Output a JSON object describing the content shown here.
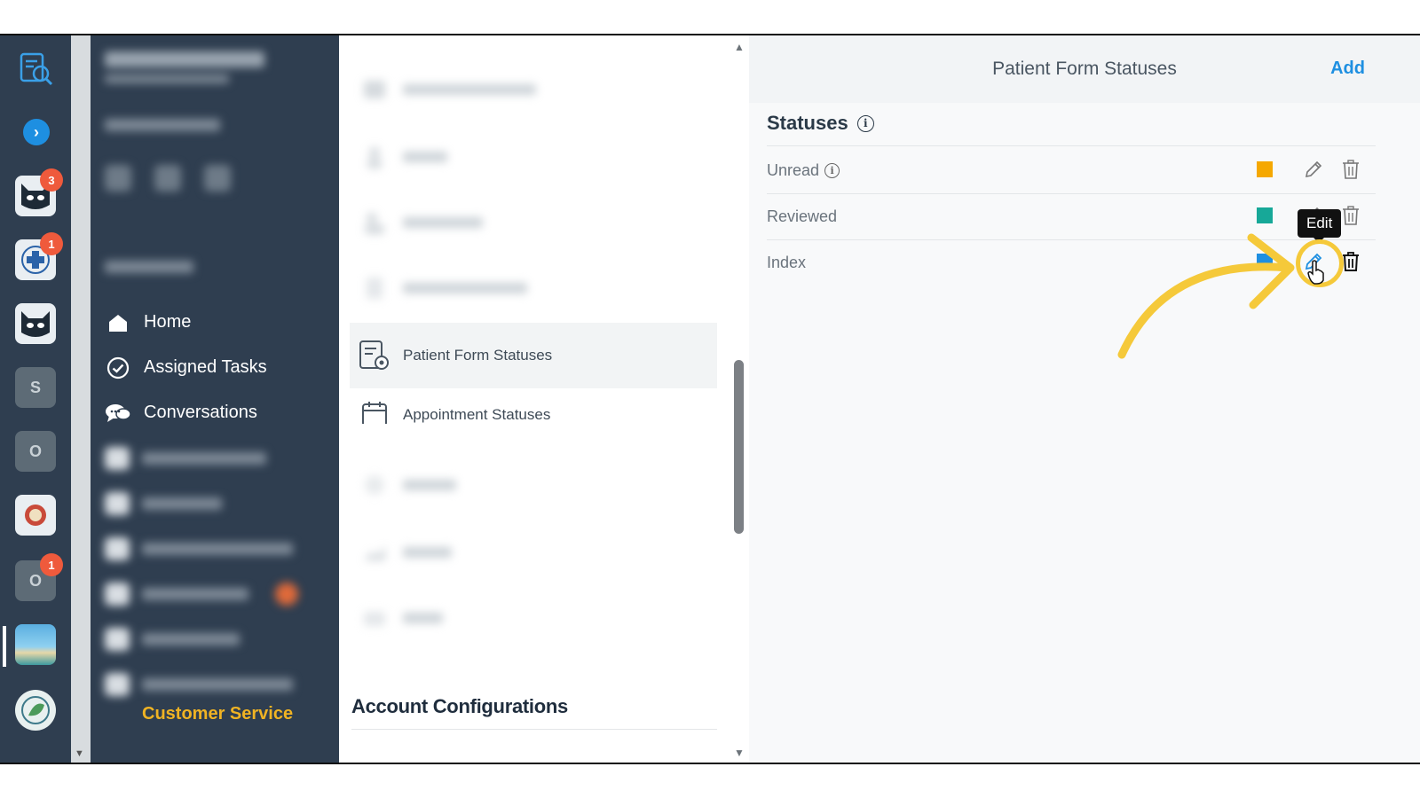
{
  "rail": {
    "badges": [
      "3",
      "1",
      "1"
    ],
    "tiles": [
      "S",
      "O",
      "O"
    ]
  },
  "sidebar": {
    "menu": [
      {
        "label": "Home"
      },
      {
        "label": "Assigned Tasks"
      },
      {
        "label": "Conversations"
      }
    ],
    "footer_label": "Customer Service"
  },
  "config": {
    "active_item": "Patient Form Statuses",
    "next_item": "Appointment Statuses",
    "section_title": "Account Configurations"
  },
  "detail": {
    "title": "Patient Form Statuses",
    "add_label": "Add",
    "statuses_heading": "Statuses",
    "statuses": [
      {
        "name": "Unread",
        "color": "#f5a800",
        "has_info": true
      },
      {
        "name": "Reviewed",
        "color": "#17a898",
        "has_info": false
      },
      {
        "name": "Index",
        "color": "#1e8fe1",
        "has_info": false
      }
    ],
    "tooltip": "Edit"
  },
  "colors": {
    "sidebar_bg": "#2f3e50",
    "accent_blue": "#1e8fe1",
    "highlight_yellow": "#f5c93a",
    "customer_service": "#f0b323",
    "badge_red": "#ef5a3c"
  }
}
